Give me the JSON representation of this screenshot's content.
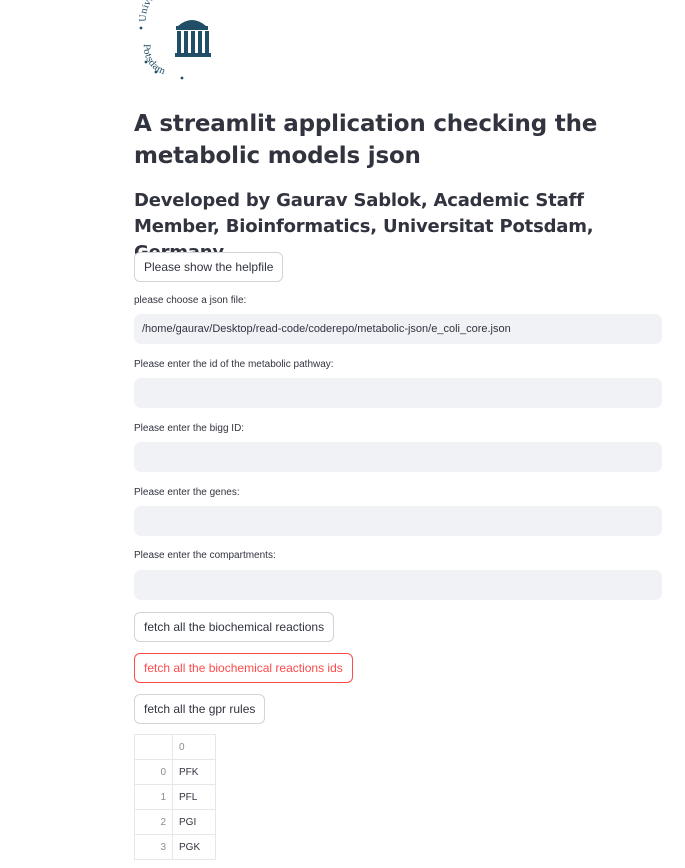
{
  "logo": {
    "text_top": "Universität",
    "text_bottom": "Potsdam"
  },
  "title": "A streamlit application checking the metabolic models json",
  "subtitle": "Developed by Gaurav Sablok, Academic Staff Member, Bioinformatics, Universitat Potsdam, Germany",
  "buttons": {
    "helpfile": "Please show the helpfile",
    "fetch_reactions": "fetch all the biochemical reactions",
    "fetch_reaction_ids": "fetch all the biochemical reactions ids",
    "fetch_gpr": "fetch all the gpr rules"
  },
  "fields": {
    "json_file": {
      "label": "please choose a json file:",
      "value": "/home/gaurav/Desktop/read-code/coderepo/metabolic-json/e_coli_core.json"
    },
    "pathway_id": {
      "label": "Please enter the id of the metabolic pathway:",
      "value": ""
    },
    "bigg_id": {
      "label": "Please enter the bigg ID:",
      "value": ""
    },
    "genes": {
      "label": "Please enter the genes:",
      "value": ""
    },
    "compartments": {
      "label": "Please enter the compartments:",
      "value": ""
    }
  },
  "table": {
    "column_header": "0",
    "rows": [
      {
        "index": "0",
        "value": "PFK"
      },
      {
        "index": "1",
        "value": "PFL"
      },
      {
        "index": "2",
        "value": "PGI"
      },
      {
        "index": "3",
        "value": "PGK"
      }
    ]
  },
  "colors": {
    "accent": "#ff4b4b",
    "input_bg": "#f0f2f6",
    "logo": "#1f4e66"
  }
}
